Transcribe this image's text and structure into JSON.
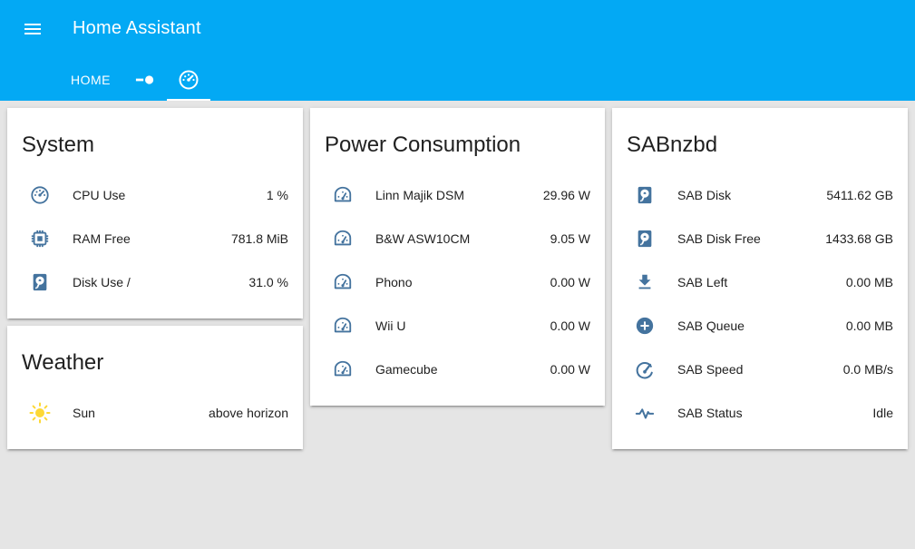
{
  "app": {
    "title": "Home Assistant"
  },
  "tabs": [
    {
      "label": "HOME",
      "icon": null
    },
    {
      "label": "",
      "icon": "toggle-switch-icon"
    },
    {
      "label": "",
      "icon": "gauge-icon",
      "active": true
    }
  ],
  "colors": {
    "header": "#03a9f4",
    "icon": "#44739e",
    "sun": "#fdd835",
    "background": "#e5e5e5"
  },
  "cards": {
    "system": {
      "title": "System",
      "rows": [
        {
          "name": "CPU Use",
          "value": "1 %",
          "icon": "gauge-icon"
        },
        {
          "name": "RAM Free",
          "value": "781.8 MiB",
          "icon": "memory-chip-icon"
        },
        {
          "name": "Disk Use /",
          "value": "31.0 %",
          "icon": "harddisk-icon"
        }
      ]
    },
    "weather": {
      "title": "Weather",
      "rows": [
        {
          "name": "Sun",
          "value": "above horizon",
          "icon": "sun-icon"
        }
      ]
    },
    "power": {
      "title": "Power Consumption",
      "rows": [
        {
          "name": "Linn Majik DSM",
          "value": "29.96 W",
          "icon": "power-meter-icon"
        },
        {
          "name": "B&W ASW10CM",
          "value": "9.05 W",
          "icon": "power-meter-icon"
        },
        {
          "name": "Phono",
          "value": "0.00 W",
          "icon": "power-meter-icon"
        },
        {
          "name": "Wii U",
          "value": "0.00 W",
          "icon": "power-meter-icon"
        },
        {
          "name": "Gamecube",
          "value": "0.00 W",
          "icon": "power-meter-icon"
        }
      ]
    },
    "sab": {
      "title": "SABnzbd",
      "rows": [
        {
          "name": "SAB Disk",
          "value": "5411.62 GB",
          "icon": "harddisk-icon"
        },
        {
          "name": "SAB Disk Free",
          "value": "1433.68 GB",
          "icon": "harddisk-icon"
        },
        {
          "name": "SAB Left",
          "value": "0.00 MB",
          "icon": "download-icon"
        },
        {
          "name": "SAB Queue",
          "value": "0.00 MB",
          "icon": "plus-circle-icon"
        },
        {
          "name": "SAB Speed",
          "value": "0.0 MB/s",
          "icon": "speedometer-icon"
        },
        {
          "name": "SAB Status",
          "value": "Idle",
          "icon": "pulse-icon"
        }
      ]
    }
  }
}
